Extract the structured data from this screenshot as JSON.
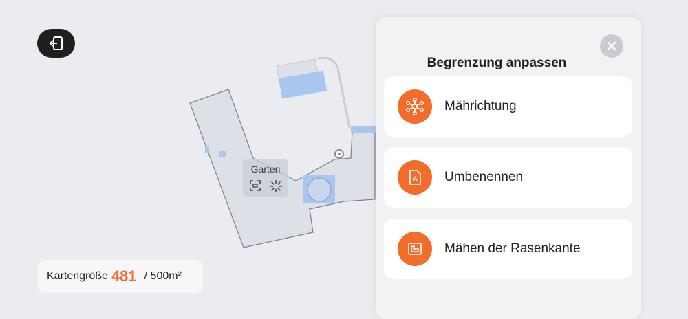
{
  "map": {
    "zone_name": "Garten",
    "size_label": "Kartengröße",
    "size_value": "481",
    "size_total": "/ 500m²"
  },
  "panel": {
    "title": "Begrenzung anpassen",
    "items": [
      {
        "label": "Mährichtung",
        "icon": "mowing-direction-icon"
      },
      {
        "label": "Umbenennen",
        "icon": "rename-icon"
      },
      {
        "label": "Mähen der Rasenkante",
        "icon": "edge-mowing-icon"
      }
    ]
  },
  "colors": {
    "accent": "#f26c2a",
    "map_fill": "#dfe2e8",
    "obstacle": "#a9c6ee"
  }
}
